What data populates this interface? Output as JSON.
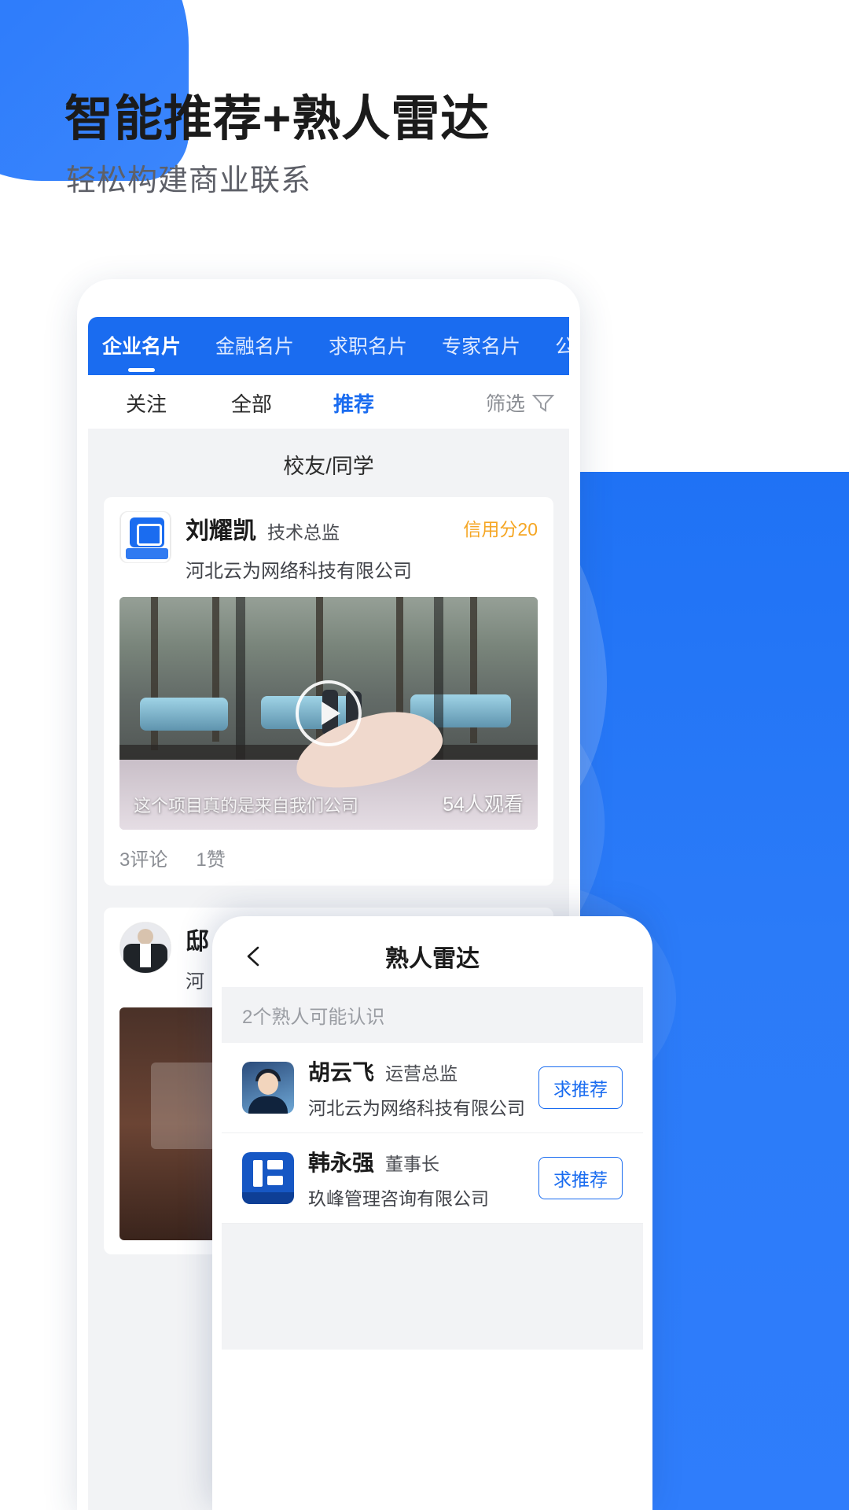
{
  "hero": {
    "headline": "智能推荐+熟人雷达",
    "subhead": "轻松构建商业联系"
  },
  "colors": {
    "brand_blue": "#1a6cf0",
    "bg_blue": "#2f7dfb",
    "credit_orange": "#f5a623",
    "muted": "#8a8d93"
  },
  "phone": {
    "tabs": [
      {
        "label": "企业名片",
        "active": true
      },
      {
        "label": "金融名片",
        "active": false
      },
      {
        "label": "求职名片",
        "active": false
      },
      {
        "label": "专家名片",
        "active": false
      },
      {
        "label": "公",
        "active": false
      }
    ],
    "subtabs": [
      {
        "label": "关注",
        "active": false
      },
      {
        "label": "全部",
        "active": false
      },
      {
        "label": "推荐",
        "active": true
      }
    ],
    "filter_label": "筛选",
    "section_title": "校友/同学",
    "cards": [
      {
        "avatar_icon": "company-logo-icon",
        "name": "刘耀凯",
        "title": "技术总监",
        "company": "河北云为网络科技有限公司",
        "credit": "信用分20",
        "video": {
          "caption": "这个项目真的是来自我们公司",
          "views": "54人观看",
          "play_icon": "play-icon"
        },
        "comments": "3评论",
        "likes": "1赞"
      },
      {
        "avatar_icon": "person-avatar-icon",
        "name": "邸",
        "title": "",
        "company": "河",
        "credit": "",
        "video": {
          "caption": "",
          "views": "",
          "play_icon": "play-icon"
        },
        "comments": "",
        "likes": ""
      }
    ]
  },
  "overlay": {
    "back_icon": "chevron-left-icon",
    "title": "熟人雷达",
    "subtitle": "2个熟人可能认识",
    "rows": [
      {
        "avatar_icon": "person-avatar-icon",
        "name": "胡云飞",
        "role": "运营总监",
        "company": "河北云为网络科技有限公司",
        "button": "求推荐"
      },
      {
        "avatar_icon": "company-logo-icon",
        "name": "韩永强",
        "role": "董事长",
        "company": "玖峰管理咨询有限公司",
        "button": "求推荐"
      }
    ]
  }
}
